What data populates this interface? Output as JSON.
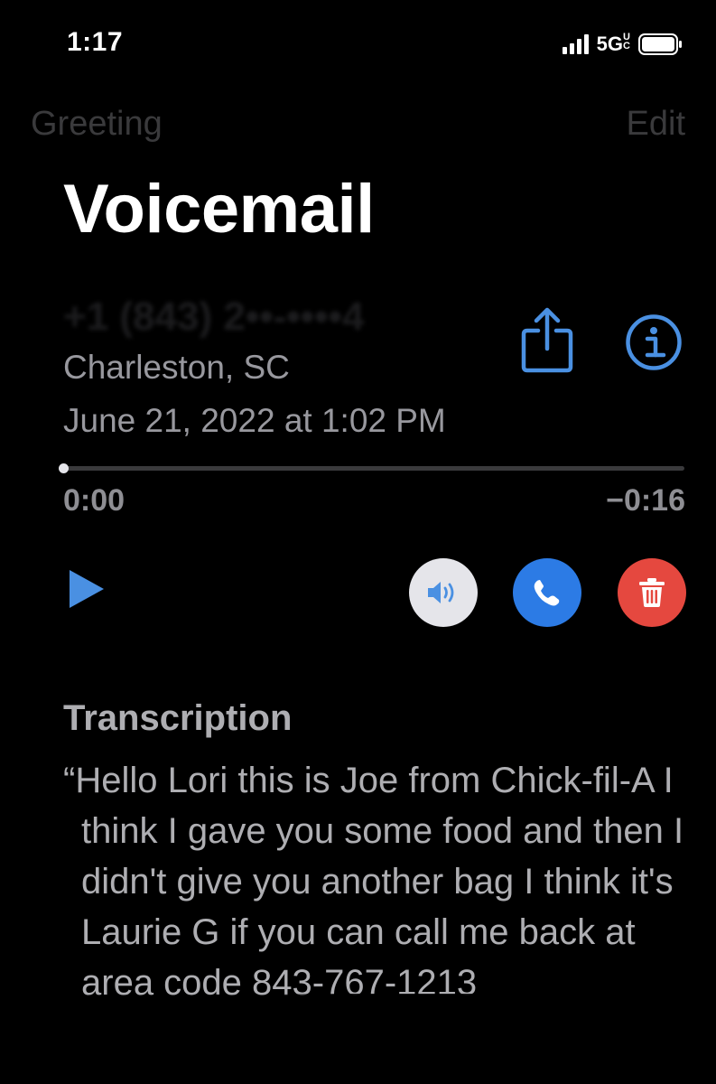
{
  "status_bar": {
    "time": "1:17",
    "network": "5G",
    "network_suffix": "UC"
  },
  "nav": {
    "left_label": "Greeting",
    "right_label": "Edit"
  },
  "page": {
    "title": "Voicemail"
  },
  "voicemail": {
    "caller_number": "+1 (843) 2••-••••4",
    "location": "Charleston, SC",
    "date": "June 21, 2022 at 1:02 PM",
    "elapsed": "0:00",
    "remaining": "−0:16",
    "progress": 0
  },
  "icons": {
    "share": "share-icon",
    "info": "info-icon",
    "play": "play-icon",
    "speaker": "speaker-icon",
    "call": "phone-icon",
    "delete": "trash-icon"
  },
  "transcription": {
    "heading": "Transcription",
    "text": "“Hello Lori this is Joe from Chick-fil-A I think I gave you some food and then I didn't give you another bag I think it's Laurie G if you can call me back at area code 843-767-1213"
  },
  "colors": {
    "accent_blue": "#4a90e2",
    "call_blue": "#2c7be5",
    "delete_red": "#e5483f",
    "speaker_bg": "#e5e5ea",
    "secondary_text": "#98989e"
  }
}
